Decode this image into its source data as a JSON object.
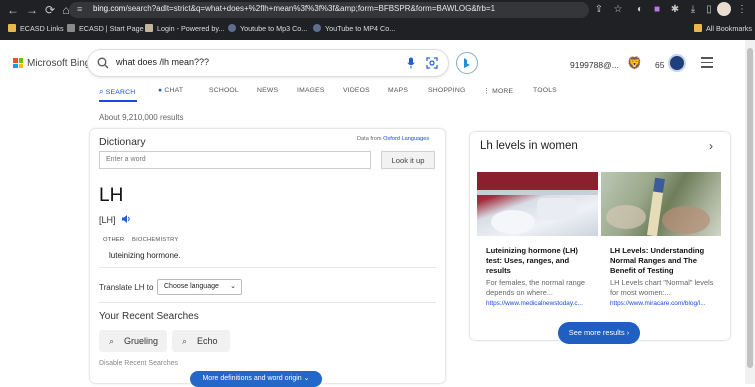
{
  "browser": {
    "url_host": "bing.com",
    "url_rest": "/search?adlt=strict&q=what+does+%2flh+mean%3f%3f%3f&amp;form=BFBSPR&form=BAWLOG&frb=1",
    "bookmarks": [
      {
        "label": "ECASD Links",
        "icon": "folder-icon"
      },
      {
        "label": "ECASD | Start Page",
        "icon": "page-icon"
      },
      {
        "label": "Login - Powered by...",
        "icon": "login-icon"
      },
      {
        "label": "Youtube to Mp3 Co...",
        "icon": "globe-icon"
      },
      {
        "label": "YouTube to MP4 Co...",
        "icon": "globe-icon"
      }
    ],
    "all_bookmarks": "All Bookmarks"
  },
  "header": {
    "brand": "Microsoft Bing",
    "query": "what does /lh mean???",
    "user": "9199788@...",
    "points": "65"
  },
  "tabs": [
    "SEARCH",
    "CHAT",
    "SCHOOL",
    "NEWS",
    "IMAGES",
    "VIDEOS",
    "MAPS",
    "SHOPPING",
    "⋮ MORE",
    "TOOLS"
  ],
  "results_count": "About 9,210,000 results",
  "dictionary": {
    "title": "Dictionary",
    "source_prefix": "Data from",
    "source_name": "Oxford Languages",
    "input_placeholder": "Enter a word",
    "lookup_label": "Look it up",
    "headword": "LH",
    "pronunciation": "[LH]",
    "part_of_speech": "OTHER",
    "domain": "BIOCHEMISTRY",
    "definition": "luteinizing hormone.",
    "translate_label": "Translate LH to",
    "language_selected": "Choose language",
    "recent_title": "Your Recent Searches",
    "recent": [
      "Grueling",
      "Echo"
    ],
    "disable_recent": "Disable Recent Searches",
    "more_definitions": "More definitions and word origin"
  },
  "side_panel": {
    "title": "Lh levels in women",
    "cards": [
      {
        "title": "Luteinizing hormone (LH) test: Uses, ranges, and results",
        "snippet": "For females, the normal range depends on where...",
        "link": "https://www.medicalnewstoday.c..."
      },
      {
        "title": "LH Levels: Understanding Normal Ranges and The Benefit of Testing",
        "snippet": "LH Levels chart \"Normal\" levels for most women:...",
        "link": "https://www.miracare.com/blog/l..."
      }
    ],
    "see_more": "See more results"
  },
  "colors": {
    "accent": "#174ae4",
    "button_blue": "#1e5fbf",
    "chrome_dark": "#202124"
  }
}
